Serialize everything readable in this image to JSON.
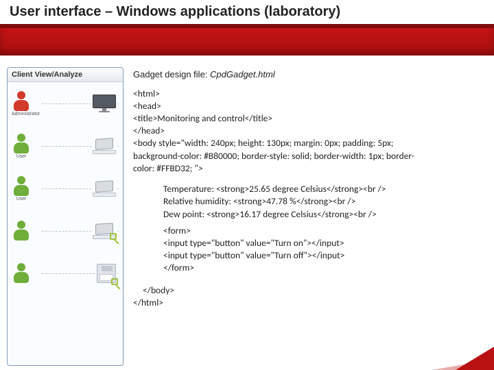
{
  "title": "User interface – Windows applications (laboratory)",
  "sidebar": {
    "header": "Client View/Analyze",
    "rows": [
      {
        "actor_color": "red",
        "actor_label": "Administrator",
        "device": "monitor"
      },
      {
        "actor_color": "green",
        "actor_label": "User",
        "device": "laptop"
      },
      {
        "actor_color": "green",
        "actor_label": "User",
        "device": "laptop"
      },
      {
        "actor_color": "green",
        "actor_label": "",
        "device": "laptop-plug"
      },
      {
        "actor_color": "green",
        "actor_label": "",
        "device": "floppy-plug"
      }
    ]
  },
  "design_label": "Gadget design file: ",
  "design_filename": "CpdGadget.html",
  "code": {
    "l1": "<html>",
    "l2": "  <head>",
    "l3": "    <title>Monitoring and control</title>",
    "l4": "  </head>",
    "l5a": "  <body style=\"width: 240px; height: 130px; margin: 0px; padding: 5px;",
    "l5b": "background-color: #B80000; border-style: solid; border-width: 1px; border-",
    "l5c": "color: #FFBD32; \">",
    "b1": "Temperature: <strong>25.65 degree Celsius</strong><br />",
    "b2": "Relative humidity: <strong>47.78 %</strong><br />",
    "b3": "Dew point: <strong>16.17 degree Celsius</strong><br />",
    "f1": "<form>",
    "f2": "  <input type=\"button\" value=\"Turn on\"></input>",
    "f3": "  <input type=\"button\" value=\"Turn off\"></input>",
    "f4": "</form>",
    "c1": "</body>",
    "c2": "</html>"
  }
}
